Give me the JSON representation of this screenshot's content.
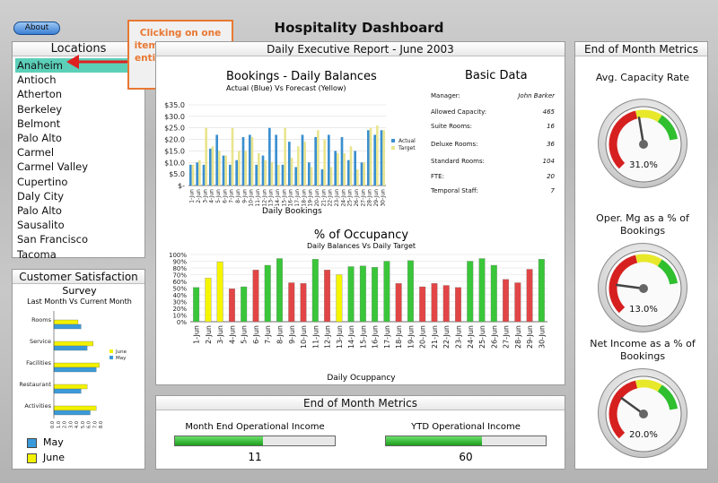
{
  "header": {
    "about_label": "About",
    "title": "Hospitality Dashboard"
  },
  "callout": {
    "text": "Clicking on one item changes the entire dashboard"
  },
  "locations": {
    "title": "Locations",
    "selected": "Anaheim",
    "items": [
      "Anaheim",
      "Antioch",
      "Atherton",
      "Berkeley",
      "Belmont",
      "Palo Alto",
      "Carmel",
      "Carmel Valley",
      "Cupertino",
      "Daly City",
      "Palo Alto",
      "Sausalito",
      "San Francisco",
      "Tacoma"
    ]
  },
  "satisfaction": {
    "title": "Customer Satisfaction",
    "subtitle1": "Survey",
    "subtitle2": "Last Month Vs Current Month",
    "legend_may": "May",
    "legend_june": "June",
    "small_legend": [
      "June",
      "May"
    ],
    "colors": {
      "may": "#3a9ad9",
      "june": "#f2f200"
    }
  },
  "report": {
    "title": "Daily Executive Report - June 2003",
    "bookings_title": "Bookings - Daily Balances",
    "bookings_subtitle": "Actual (Blue) Vs Forecast (Yellow)",
    "bookings_xlabel": "Daily Bookings",
    "bookings_legend": [
      "Actual",
      "Target"
    ],
    "occupancy_title": "% of Occupancy",
    "occupancy_subtitle": "Daily Balances Vs Daily Target",
    "occupancy_xlabel": "Daily Ocuppancy"
  },
  "basic_data": {
    "title": "Basic Data",
    "rows": [
      {
        "label": "Manager:",
        "value": "John Barker"
      },
      {
        "label": "Allowed Capacity:",
        "value": "465"
      },
      {
        "label": "Suite Rooms:",
        "value": "16"
      },
      {
        "label": "Deluxe Rooms:",
        "value": "36"
      },
      {
        "label": "Standard Rooms:",
        "value": "104"
      },
      {
        "label": "FTE:",
        "value": "20"
      },
      {
        "label": "Temporal Staff:",
        "value": "7"
      }
    ]
  },
  "month_end": {
    "title": "End of Month Metrics",
    "op_income_label": "Month End Operational Income",
    "op_income_value": "11",
    "op_income_fill": 0.55,
    "ytd_label": "YTD Operational Income",
    "ytd_value": "60",
    "ytd_fill": 0.6
  },
  "gauges": {
    "title": "End of Month Metrics",
    "items": [
      {
        "label": "Avg. Capacity Rate",
        "value": "31.0%",
        "level": 0.31
      },
      {
        "label": "Oper. Mg as a % of Bookings",
        "value": "13.0%",
        "level": 0.13
      },
      {
        "label": "Net Income as a % of Bookings",
        "value": "20.0%",
        "level": 0.2
      }
    ]
  },
  "chart_data": [
    {
      "type": "bar",
      "title": "Bookings - Daily Balances",
      "subtitle": "Actual (Blue) Vs Forecast (Yellow)",
      "xlabel": "Daily Bookings",
      "ylabel": "",
      "ylim": [
        0,
        35
      ],
      "yticks": [
        "$-",
        "$5.0",
        "$10.0",
        "$15.0",
        "$20.0",
        "$25.0",
        "$30.0",
        "$35.0"
      ],
      "categories": [
        "1-Jun",
        "2-Jun",
        "3-Jun",
        "4-Jun",
        "5-Jun",
        "6-Jun",
        "7-Jun",
        "8-Jun",
        "9-Jun",
        "10-Jun",
        "11-Jun",
        "12-Jun",
        "13-Jun",
        "14-Jun",
        "15-Jun",
        "16-Jun",
        "17-Jun",
        "18-Jun",
        "19-Jun",
        "20-Jun",
        "21-Jun",
        "22-Jun",
        "23-Jun",
        "24-Jun",
        "25-Jun",
        "26-Jun",
        "27-Jun",
        "28-Jun",
        "29-Jun",
        "30-Jun"
      ],
      "series": [
        {
          "name": "Actual",
          "color": "#3a8fd0",
          "values": [
            9,
            10,
            9,
            16,
            22,
            13,
            9,
            11,
            21,
            22,
            9,
            13,
            25,
            22,
            9,
            19,
            8,
            22,
            10,
            21,
            7,
            22,
            15,
            21,
            11,
            15,
            10,
            24,
            22,
            24
          ]
        },
        {
          "name": "Target",
          "color": "#e9e58f",
          "values": [
            9,
            11,
            25,
            17,
            15,
            13,
            25,
            15,
            15,
            21,
            14,
            11,
            10,
            9,
            25,
            12,
            17,
            19,
            8,
            24,
            20,
            8,
            14,
            14,
            17,
            7,
            10,
            25,
            26,
            24
          ]
        }
      ],
      "legend": "right"
    },
    {
      "type": "bar",
      "title": "% of Occupancy",
      "subtitle": "Daily Balances Vs Daily Target",
      "xlabel": "Daily Ocuppancy",
      "ylim": [
        0,
        100
      ],
      "yticks": [
        "0%",
        "10%",
        "20%",
        "30%",
        "40%",
        "50%",
        "60%",
        "70%",
        "80%",
        "90%",
        "100%"
      ],
      "categories": [
        "1-Jun",
        "2-Jun",
        "3-Jun",
        "4-Jun",
        "5-Jun",
        "6-Jun",
        "7-Jun",
        "8-Jun",
        "9-Jun",
        "10-Jun",
        "11-Jun",
        "12-Jun",
        "13-Jun",
        "14-Jun",
        "15-Jun",
        "16-Jun",
        "17-Jun",
        "18-Jun",
        "19-Jun",
        "20-Jun",
        "21-Jun",
        "22-Jun",
        "23-Jun",
        "24-Jun",
        "25-Jun",
        "26-Jun",
        "27-Jun",
        "28-Jun",
        "29-Jun",
        "30-Jun"
      ],
      "values": [
        51,
        65,
        89,
        49,
        52,
        77,
        84,
        94,
        58,
        57,
        93,
        77,
        70,
        82,
        83,
        81,
        90,
        57,
        91,
        52,
        57,
        54,
        51,
        90,
        94,
        84,
        63,
        58,
        78,
        93
      ],
      "bar_colors": [
        "#39c639",
        "#f5f500",
        "#f5f500",
        "#e24545",
        "#39c639",
        "#e24545",
        "#39c639",
        "#39c639",
        "#e24545",
        "#e24545",
        "#39c639",
        "#e24545",
        "#f5f500",
        "#39c639",
        "#39c639",
        "#39c639",
        "#39c639",
        "#e24545",
        "#39c639",
        "#e24545",
        "#e24545",
        "#e24545",
        "#e24545",
        "#39c639",
        "#39c639",
        "#39c639",
        "#e24545",
        "#e24545",
        "#e24545",
        "#39c639"
      ]
    },
    {
      "type": "bar",
      "title": "Survey",
      "subtitle": "Last Month Vs Current Month",
      "orientation": "horizontal",
      "categories": [
        "Rooms",
        "Service",
        "Facilities",
        "Restaurant",
        "Activities"
      ],
      "xticks": [
        "0.0",
        "1.0",
        "2.0",
        "3.0",
        "4.0",
        "5.0",
        "6.0",
        "7.0",
        "8.0"
      ],
      "xlim": [
        0,
        8
      ],
      "series": [
        {
          "name": "June",
          "color": "#f2f200",
          "values": [
            4.0,
            6.5,
            7.5,
            5.5,
            7.0
          ]
        },
        {
          "name": "May",
          "color": "#3a9ad9",
          "values": [
            4.5,
            5.5,
            7.0,
            4.5,
            6.0
          ]
        }
      ]
    }
  ]
}
